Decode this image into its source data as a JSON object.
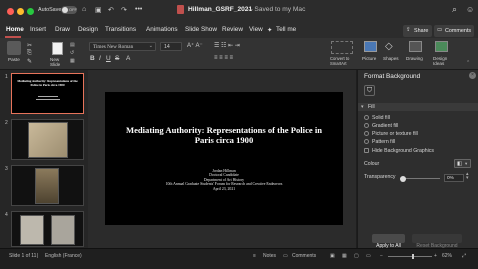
{
  "titlebar": {
    "autosave_label": "AutoSave",
    "autosave_state": "OFF",
    "doc_title": "Hillman_GSRF_2021",
    "doc_status": "— Saved to my Mac",
    "search_icon": "search-icon",
    "share_label": "Share",
    "comments_label": "Comments"
  },
  "menu": {
    "tabs": [
      "Home",
      "Insert",
      "Draw",
      "Design",
      "Transitions",
      "Animations",
      "Slide Show",
      "Review",
      "View"
    ],
    "tell_me": "Tell me"
  },
  "ribbon": {
    "paste_label": "Paste",
    "new_slide_label": "New\nSlide",
    "font_name": "Times New Roman",
    "font_size": "14",
    "picture_label": "Picture",
    "shapes_label": "Shapes",
    "convert_label": "Convert to\nSmartArt",
    "drawing_label": "Drawing",
    "design_ideas_label": "Design\nIdeas"
  },
  "thumbnails": [
    {
      "num": "1",
      "selected": true
    },
    {
      "num": "2",
      "selected": false
    },
    {
      "num": "3",
      "selected": false
    },
    {
      "num": "4",
      "selected": false
    }
  ],
  "slide": {
    "title": "Mediating Authority: Representations of the Police in Paris circa 1900",
    "name": "Jordan Hillman",
    "role": "Doctoral Candidate",
    "dept": "Department of Art History",
    "event": "10th Annual Graduate Students' Forum for Research and Creative Endeavors",
    "date": "April 23, 2021"
  },
  "thumb1": {
    "title": "Mediating Authority: Representations of the Police in Paris circa 1900"
  },
  "panel": {
    "title": "Format Background",
    "section": "Fill",
    "options": [
      "Solid fill",
      "Gradient fill",
      "Picture or texture fill",
      "Pattern fill"
    ],
    "hide_graphics": "Hide Background Graphics",
    "colour_label": "Colour",
    "transparency_label": "Transparency",
    "transparency_value": "0%",
    "transparency_fraction": 0,
    "apply_all": "Apply to All",
    "reset": "Reset Background",
    "colour_swatch": "#ffffff",
    "accent": "#c0504d"
  },
  "status": {
    "slide_info": "Slide 1 of 11",
    "language": "English (France)",
    "notes": "Notes",
    "comments": "Comments",
    "zoom": "62%"
  }
}
